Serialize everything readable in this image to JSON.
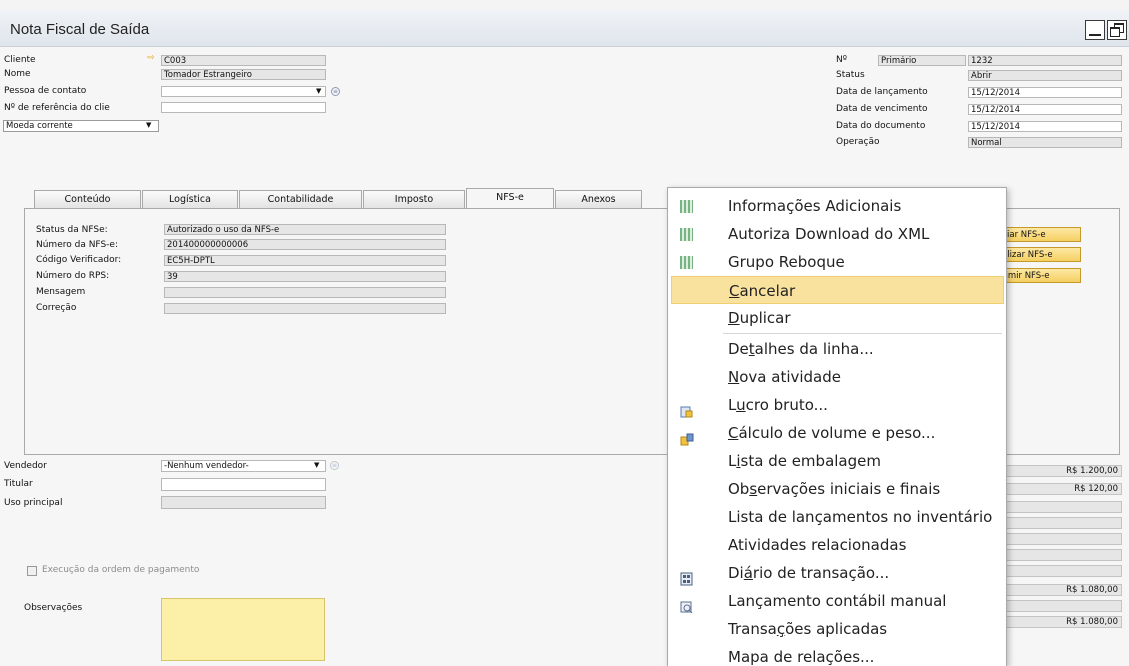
{
  "window": {
    "title": "Nota Fiscal de Saída"
  },
  "header_left": {
    "cliente": {
      "label": "Cliente",
      "value": "C003"
    },
    "nome": {
      "label": "Nome",
      "value": "Tomador Estrangeiro"
    },
    "pessoa_contato": {
      "label": "Pessoa de contato",
      "value": ""
    },
    "num_ref": {
      "label": "Nº de referência do clie",
      "value": ""
    },
    "moeda": {
      "value": "Moeda corrente"
    }
  },
  "header_right": {
    "numero": {
      "label": "Nº",
      "series": "Primário",
      "value": "1232"
    },
    "status": {
      "label": "Status",
      "value": "Abrir"
    },
    "data_lancamento": {
      "label": "Data de lançamento",
      "value": "15/12/2014"
    },
    "data_vencimento": {
      "label": "Data de vencimento",
      "value": "15/12/2014"
    },
    "data_documento": {
      "label": "Data do documento",
      "value": "15/12/2014"
    },
    "operacao": {
      "label": "Operação",
      "value": "Normal"
    }
  },
  "tabs": [
    {
      "label": "Conteúdo"
    },
    {
      "label": "Logística"
    },
    {
      "label": "Contabilidade"
    },
    {
      "label": "Imposto"
    },
    {
      "label": "NFS-e"
    },
    {
      "label": "Anexos"
    }
  ],
  "nfse": {
    "status": {
      "label": "Status da NFSe:",
      "value": "Autorizado o uso da NFS-e"
    },
    "numero": {
      "label": "Número da NFS-e:",
      "value": "201400000000006"
    },
    "codigo": {
      "label": "Código Verificador:",
      "value": "EC5H-DPTL"
    },
    "rps": {
      "label": "Número do RPS:",
      "value": "39"
    },
    "mensagem": {
      "label": "Mensagem",
      "value": ""
    },
    "correcao": {
      "label": "Correção",
      "value": ""
    }
  },
  "side_buttons": [
    "viar NFS-e",
    "alizar NFS-e",
    "rimir NFS-e"
  ],
  "lower_left": {
    "vendedor": {
      "label": "Vendedor",
      "value": "-Nenhum vendedor-"
    },
    "titular": {
      "label": "Titular",
      "value": ""
    },
    "uso_principal": {
      "label": "Uso principal",
      "value": ""
    },
    "execucao": {
      "label": "Execução da ordem de pagamento"
    },
    "observacoes": {
      "label": "Observações"
    }
  },
  "totals": [
    "R$ 1.200,00",
    "R$ 120,00",
    "R$ 1.080,00",
    "R$ 1.080,00"
  ],
  "context_menu": {
    "items": [
      {
        "label": "Informações Adicionais",
        "icon": "grid-icon"
      },
      {
        "label": "Autoriza Download do XML",
        "icon": "grid-icon"
      },
      {
        "label": "Grupo Reboque",
        "icon": "grid-icon"
      },
      {
        "label": "Cancelar",
        "underline": "C",
        "rest": "ancelar"
      },
      {
        "label": "Duplicar",
        "underline": "D",
        "rest": "uplicar"
      },
      {
        "label": "Detalhes da linha...",
        "pre": "De",
        "underline": "t",
        "rest": "alhes da linha..."
      },
      {
        "label": "Nova atividade",
        "underline": "N",
        "rest": "ova atividade"
      },
      {
        "label": "Lucro bruto...",
        "icon": "gross-profit-icon",
        "pre": "L",
        "underline": "u",
        "rest": "cro bruto..."
      },
      {
        "label": "Cálculo de volume e peso...",
        "icon": "volume-weight-icon",
        "underline": "C",
        "rest": "álculo de volume e peso..."
      },
      {
        "label": "Lista de embalagem",
        "pre": "L",
        "underline": "i",
        "rest": "sta de embalagem"
      },
      {
        "label": "Observações iniciais e finais",
        "pre": "Ob",
        "underline": "s",
        "rest": "ervações iniciais e finais"
      },
      {
        "label": "Lista de lançamentos no inventário"
      },
      {
        "label": "Atividades relacionadas"
      },
      {
        "label": "Diário de transação...",
        "icon": "journal-icon",
        "pre": "Di",
        "underline": "á",
        "rest": "rio de transação..."
      },
      {
        "label": "Lançamento contábil manual",
        "icon": "manual-entry-icon"
      },
      {
        "label": "Transações aplicadas",
        "pre": "Transa",
        "underline": "ç",
        "rest": "ões aplicadas"
      },
      {
        "label": "Mapa de relações..."
      }
    ]
  }
}
